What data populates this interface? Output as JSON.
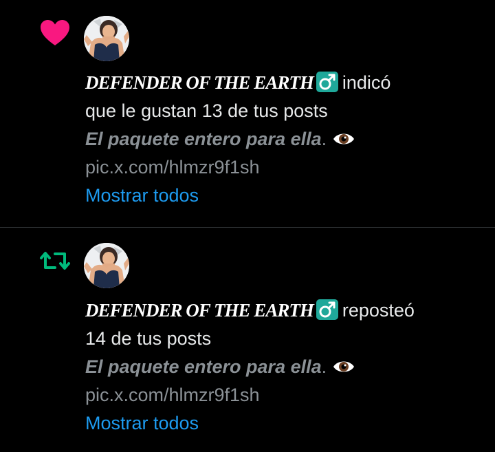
{
  "colors": {
    "background": "#000000",
    "like_pink": "#f91880",
    "repost_green": "#00ba7c",
    "link_blue": "#1d9bf0",
    "gender_teal": "#1fa89a",
    "muted_text": "#8b9196"
  },
  "notifications": [
    {
      "type_icon": "heart-icon",
      "user_name": "DEFENDER OF THE EARTH",
      "gender_icon": "male-sign-icon",
      "action_line1": "indicó",
      "action_line2": "que le gustan 13 de tus posts",
      "preview_bold": "El paquete entero para ella",
      "preview_punct": ".",
      "preview_emoji": "eye-icon",
      "preview_link": "pic.x.com/hlmzr9f1sh",
      "show_all": "Mostrar todos"
    },
    {
      "type_icon": "repost-icon",
      "user_name": "DEFENDER OF THE EARTH",
      "gender_icon": "male-sign-icon",
      "action_line1": "reposteó",
      "action_line2": "14 de tus posts",
      "preview_bold": "El paquete entero para ella",
      "preview_punct": ".",
      "preview_emoji": "eye-icon",
      "preview_link": "pic.x.com/hlmzr9f1sh",
      "show_all": "Mostrar todos"
    }
  ]
}
